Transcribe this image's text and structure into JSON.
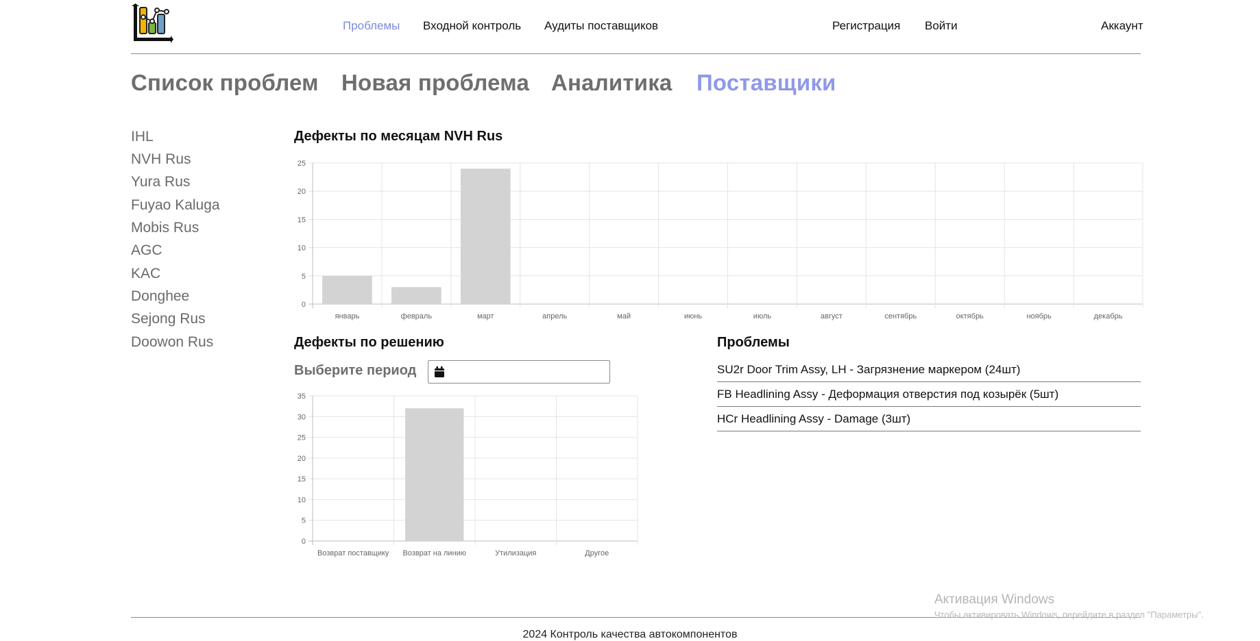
{
  "nav": {
    "links": [
      "Проблемы",
      "Входной контроль",
      "Аудиты поставщиков"
    ],
    "right_links": [
      "Регистрация",
      "Войти"
    ],
    "account": "Аккаунт"
  },
  "tabs": [
    "Список проблем",
    "Новая проблема",
    "Аналитика",
    "Поставщики"
  ],
  "suppliers": [
    "IHL",
    "NVH Rus",
    "Yura Rus",
    "Fuyao Kaluga",
    "Mobis Rus",
    "AGC",
    "KAC",
    "Donghee",
    "Sejong Rus",
    "Doowon Rus"
  ],
  "monthly_title": "Дефекты по месяцам NVH Rus",
  "decision_title": "Дефекты по решению",
  "period_label": "Выберите период",
  "problems_title": "Проблемы",
  "problems": [
    "SU2r Door Trim Assy, LH - Загрязнение маркером (24шт)",
    "FB Headlining Assy - Деформация отверстия под козырёк (5шт)",
    "HCr Headlining Assy - Damage (3шт)"
  ],
  "chart_data": [
    {
      "type": "bar",
      "title": "Дефекты по месяцам NVH Rus",
      "categories": [
        "январь",
        "февраль",
        "март",
        "апрель",
        "май",
        "июнь",
        "июль",
        "август",
        "сентябрь",
        "октябрь",
        "ноябрь",
        "декабрь"
      ],
      "values": [
        5,
        3,
        24,
        0,
        0,
        0,
        0,
        0,
        0,
        0,
        0,
        0
      ],
      "ylim": [
        0,
        25
      ],
      "yticks": [
        0,
        5,
        10,
        15,
        20,
        25
      ],
      "grid": true,
      "bar_color": "#d3d3d3"
    },
    {
      "type": "bar",
      "title": "Дефекты по решению",
      "categories": [
        "Возврат поставщику",
        "Возврат на линию",
        "Утилизация",
        "Другое"
      ],
      "values": [
        0,
        32,
        0,
        0
      ],
      "ylim": [
        0,
        35
      ],
      "yticks": [
        0,
        5,
        10,
        15,
        20,
        25,
        30,
        35
      ],
      "grid": true,
      "bar_color": "#d3d3d3"
    }
  ],
  "footer": "2024 Контроль качества автокомпонентов",
  "watermark": {
    "title": "Активация Windows",
    "subtitle": "Чтобы активировать Windows, перейдите в раздел \"Параметры\"."
  },
  "colors": {
    "accent": "#7f8be0",
    "tab_active": "#8f99e8",
    "muted": "#6e6e6e"
  }
}
